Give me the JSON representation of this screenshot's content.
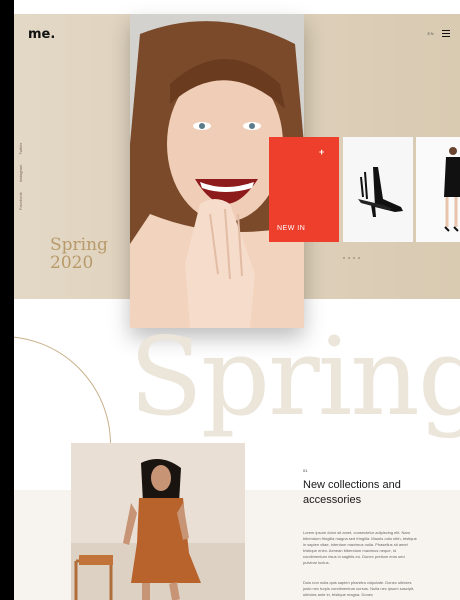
{
  "brand": {
    "logo": "me."
  },
  "nav": {
    "language": "EN",
    "menu_icon": "hamburger-icon"
  },
  "social": [
    "Facebook",
    "Instagram",
    "Twitter"
  ],
  "hero": {
    "title_line1": "Spring",
    "title_line2": "2020"
  },
  "promo": {
    "label": "NEW IN",
    "plus": "+"
  },
  "slider": {
    "dot_count": 4
  },
  "decor_word": "Spring",
  "section": {
    "number": "01",
    "heading": "New collections and accessories",
    "paragraph1": "Lorem ipsum dolor sit amet, consectetur adipiscing elit. Nam bibendum fringilla magna sed fringilla. Mauris odio nibh, tristique in sapien vitae, interdum maximus nulla. Phasellus sit amet tristique enim. Aenean bibendum maximus neque, id condimentum risus in sagittis eu. Donec pretium eros sed pulvinar luctus.",
    "paragraph2": "Duis non nulla quis sapien pharetra vulputate. Donec ultricies justo nec turpis condimentum cursus. Nulla nec ipsum suscipit, ultricies ante in, tristique magna. Donec"
  },
  "colors": {
    "accent": "#ee3e2c",
    "gold": "#b89a6a",
    "beige": "#e3d8c6"
  }
}
